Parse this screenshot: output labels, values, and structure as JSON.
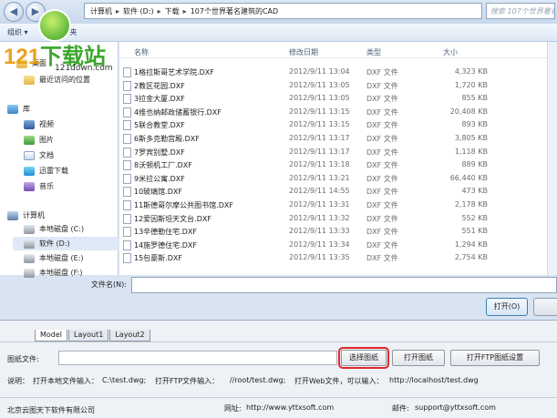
{
  "colors": {
    "accent": "#3c7fb1",
    "highlight_border": "#e3262a",
    "logo_orange": "#e9a21c",
    "logo_green": "#3ba62c"
  },
  "address": {
    "crumbs": [
      "计算机",
      "软件 (D:)",
      "下载",
      "107个世界著名建筑的CAD"
    ],
    "search_placeholder": "搜索 107个世界著名..."
  },
  "toolbar": {
    "organize": "组织 ▾",
    "new_folder": "新建文件夹"
  },
  "logo": {
    "number": "121",
    "text": "下载站",
    "url": "121down.com"
  },
  "nav": [
    {
      "label": "桌面",
      "icon": "desktop-icon"
    },
    {
      "label": "最近访问的位置",
      "icon": "recent-icon"
    },
    {
      "label": "库",
      "icon": "library-icon"
    },
    {
      "label": "视频",
      "icon": "video-icon"
    },
    {
      "label": "图片",
      "icon": "picture-icon"
    },
    {
      "label": "文档",
      "icon": "document-icon"
    },
    {
      "label": "迅雷下载",
      "icon": "download-icon"
    },
    {
      "label": "音乐",
      "icon": "music-icon"
    },
    {
      "label": "计算机",
      "icon": "computer-icon"
    },
    {
      "label": "本地磁盘 (C:)",
      "icon": "disk-icon"
    },
    {
      "label": "软件 (D:)",
      "icon": "disk-icon"
    },
    {
      "label": "本地磁盘 (E:)",
      "icon": "disk-icon"
    },
    {
      "label": "本地磁盘 (F:)",
      "icon": "disk-icon"
    }
  ],
  "columns": {
    "name": "名称",
    "date": "修改日期",
    "type": "类型",
    "size": "大小"
  },
  "files": [
    {
      "name": "1格拉斯哥艺术学院.DXF",
      "date": "2012/9/11 13:04",
      "type": "DXF 文件",
      "size": "4,323 KB"
    },
    {
      "name": "2教区花园.DXF",
      "date": "2012/9/11 13:05",
      "type": "DXF 文件",
      "size": "1,720 KB"
    },
    {
      "name": "3拉金大厦.DXF",
      "date": "2012/9/11 13:05",
      "type": "DXF 文件",
      "size": "855 KB"
    },
    {
      "name": "4维也纳邮政储蓄银行.DXF",
      "date": "2012/9/11 13:15",
      "type": "DXF 文件",
      "size": "20,408 KB"
    },
    {
      "name": "5联合教堂.DXF",
      "date": "2012/9/11 13:15",
      "type": "DXF 文件",
      "size": "893 KB"
    },
    {
      "name": "6斯多克勒宫殿.DXF",
      "date": "2012/9/11 13:17",
      "type": "DXF 文件",
      "size": "3,805 KB"
    },
    {
      "name": "7罗宾别墅.DXF",
      "date": "2012/9/11 13:17",
      "type": "DXF 文件",
      "size": "1,118 KB"
    },
    {
      "name": "8沃顿机工厂.DXF",
      "date": "2012/9/11 13:18",
      "type": "DXF 文件",
      "size": "889 KB"
    },
    {
      "name": "9米拉公寓.DXF",
      "date": "2012/9/11 13:21",
      "type": "DXF 文件",
      "size": "66,440 KB"
    },
    {
      "name": "10玻璃馆.DXF",
      "date": "2012/9/11 14:55",
      "type": "DXF 文件",
      "size": "473 KB"
    },
    {
      "name": "11斯德哥尔摩公共图书馆.DXF",
      "date": "2012/9/11 13:31",
      "type": "DXF 文件",
      "size": "2,178 KB"
    },
    {
      "name": "12爱因斯坦天文台.DXF",
      "date": "2012/9/11 13:32",
      "type": "DXF 文件",
      "size": "552 KB"
    },
    {
      "name": "13辛德勒住宅.DXF",
      "date": "2012/9/11 13:33",
      "type": "DXF 文件",
      "size": "551 KB"
    },
    {
      "name": "14施罗德住宅.DXF",
      "date": "2012/9/11 13:34",
      "type": "DXF 文件",
      "size": "1,294 KB"
    },
    {
      "name": "15包豪斯.DXF",
      "date": "2012/9/11 13:35",
      "type": "DXF 文件",
      "size": "2,754 KB"
    }
  ],
  "dialog": {
    "filename_label": "文件名(N):",
    "open_label": "打开(O)"
  },
  "app": {
    "tabs": [
      "Model",
      "Layout1",
      "Layout2"
    ],
    "drawing_label": "图纸文件:",
    "select_btn": "选择图纸",
    "open_btn": "打开图纸",
    "ftp_btn": "打开FTP图纸设置",
    "help": {
      "prefix": "说明：",
      "local_label": "打开本地文件输入：",
      "local_path": "C:\\test.dwg;",
      "ftp_label": "打开FTP文件输入：",
      "ftp_path": "//root/test.dwg;",
      "web_label": "打开Web文件，可以输入：",
      "web_path": "http://localhost/test.dwg"
    },
    "footer": {
      "company": "北京云图天下软件有限公司",
      "site_label": "网址:",
      "site": "http://www.yttxsoft.com",
      "mail_label": "邮件:",
      "mail": "support@yttxsoft.com"
    }
  }
}
